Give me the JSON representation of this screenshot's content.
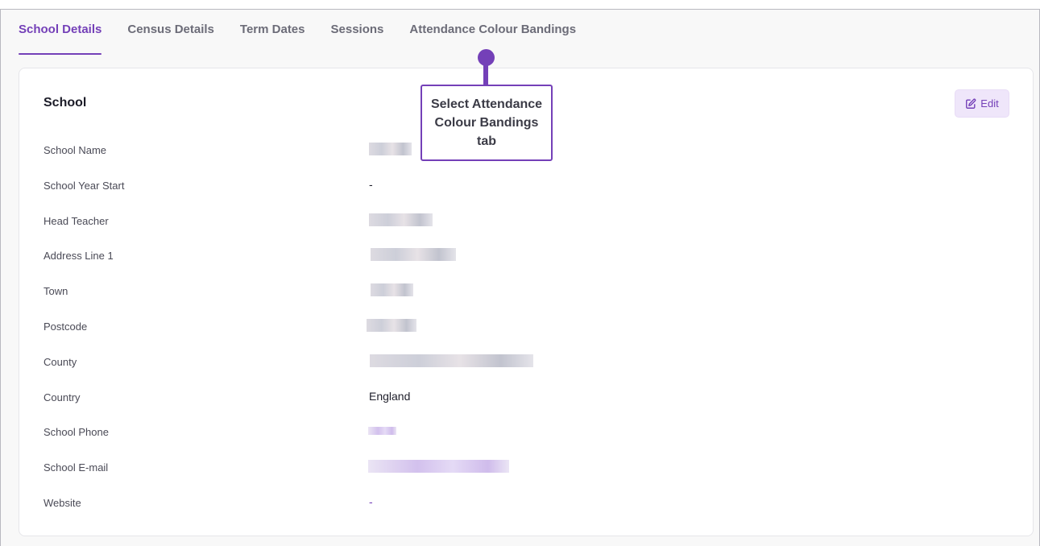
{
  "tabs": [
    {
      "label": "School Details",
      "active": true
    },
    {
      "label": "Census Details",
      "active": false
    },
    {
      "label": "Term Dates",
      "active": false
    },
    {
      "label": "Sessions",
      "active": false
    },
    {
      "label": "Attendance Colour Bandings",
      "active": false
    }
  ],
  "card": {
    "title": "School",
    "edit_label": "Edit",
    "edit_icon": "edit-square-icon",
    "rows": [
      {
        "label": "School Name",
        "value": null,
        "redacted": true
      },
      {
        "label": "School Year Start",
        "value": "-",
        "redacted": false
      },
      {
        "label": "Head Teacher",
        "value": null,
        "redacted": true
      },
      {
        "label": "Address Line 1",
        "value": null,
        "redacted": true
      },
      {
        "label": "Town",
        "value": null,
        "redacted": true
      },
      {
        "label": "Postcode",
        "value": null,
        "redacted": true
      },
      {
        "label": "County",
        "value": null,
        "redacted": true
      },
      {
        "label": "Country",
        "value": "England",
        "redacted": false
      },
      {
        "label": "School Phone",
        "value": null,
        "redacted": true
      },
      {
        "label": "School E-mail",
        "value": null,
        "redacted": true
      },
      {
        "label": "Website",
        "value": "-",
        "redacted": false
      }
    ]
  },
  "callout": {
    "text": "Select Attendance Colour Bandings tab"
  },
  "colors": {
    "accent": "#7440b8",
    "accent_light": "#efe6fa"
  }
}
